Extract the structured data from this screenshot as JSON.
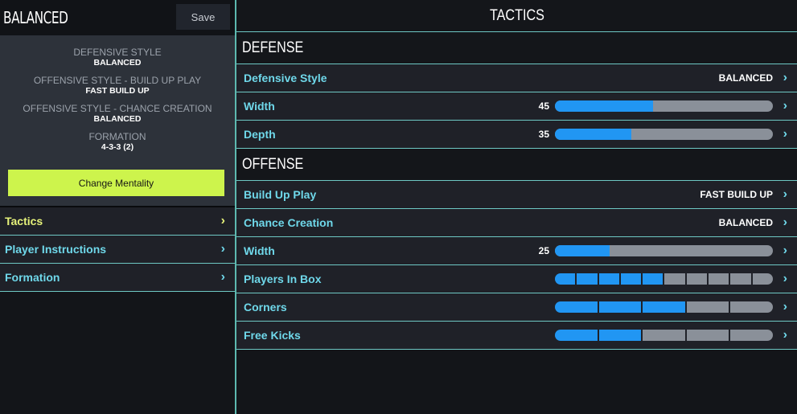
{
  "left": {
    "mentality_title": "BALANCED",
    "save_label": "Save",
    "summary": [
      {
        "label": "DEFENSIVE STYLE",
        "value": "BALANCED"
      },
      {
        "label": "OFFENSIVE STYLE - BUILD UP PLAY",
        "value": "FAST BUILD UP"
      },
      {
        "label": "OFFENSIVE STYLE - CHANCE CREATION",
        "value": "BALANCED"
      },
      {
        "label": "FORMATION",
        "value": "4-3-3 (2)"
      }
    ],
    "change_mentality_label": "Change Mentality",
    "nav": [
      {
        "label": "Tactics",
        "active": true
      },
      {
        "label": "Player Instructions",
        "active": false
      },
      {
        "label": "Formation",
        "active": false
      }
    ]
  },
  "right": {
    "title": "TACTICS",
    "defense": {
      "heading": "DEFENSE",
      "defensive_style": {
        "label": "Defensive Style",
        "value": "BALANCED"
      },
      "width": {
        "label": "Width",
        "value": 45
      },
      "depth": {
        "label": "Depth",
        "value": 35
      }
    },
    "offense": {
      "heading": "OFFENSE",
      "build_up_play": {
        "label": "Build Up Play",
        "value": "FAST BUILD UP"
      },
      "chance_creation": {
        "label": "Chance Creation",
        "value": "BALANCED"
      },
      "width": {
        "label": "Width",
        "value": 25
      },
      "players_in_box": {
        "label": "Players In Box",
        "filled": 5,
        "total": 10
      },
      "corners": {
        "label": "Corners",
        "filled": 3,
        "total": 5
      },
      "free_kicks": {
        "label": "Free Kicks",
        "filled": 2,
        "total": 5
      }
    }
  },
  "icons": {
    "chevron": "›"
  },
  "colors": {
    "accent_cyan": "#6fd8ea",
    "active_yellow": "#e6f27a",
    "button_lime": "#cdf44c",
    "slider_fill": "#2196f3",
    "slider_track": "#8a9099",
    "border": "#6ec8c4"
  }
}
